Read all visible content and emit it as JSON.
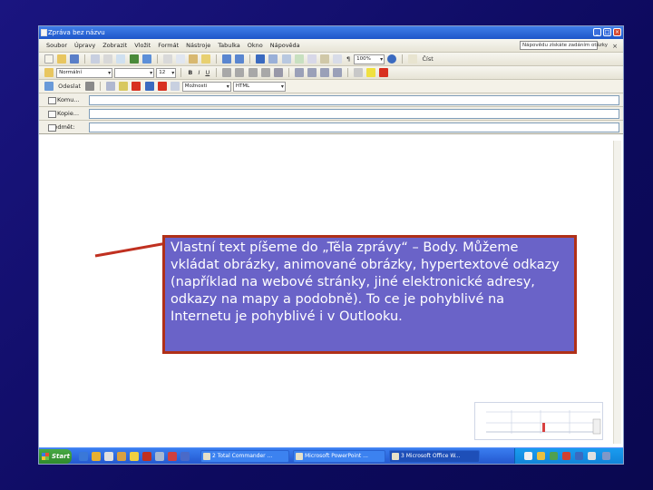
{
  "window": {
    "title": "Zpráva bez názvu"
  },
  "menu": {
    "items": [
      "Soubor",
      "Úpravy",
      "Zobrazit",
      "Vložit",
      "Formát",
      "Nástroje",
      "Tabulka",
      "Okno",
      "Nápověda"
    ],
    "help_box": "Nápovědu získáte zadáním otázky"
  },
  "toolbar": {
    "font_family": "Normální",
    "font_size": "12",
    "zoom": "100%",
    "read_label": "Číst"
  },
  "mailbar": {
    "send_label": "Odeslat",
    "account": "Možnosti",
    "format": "HTML"
  },
  "address": {
    "to_label": "Komu...",
    "cc_label": "Kopie...",
    "subject_label": "Předmět:"
  },
  "callout": {
    "text": "Vlastní text píšeme do „Těla zprávy“ – Body. Můžeme vkládat obrázky, animované obrázky, hypertextové odkazy (například na webové stránky, jiné elektronické adresy, odkazy na mapy a podobně). To ce je pohyblivé na Internetu je pohyblivé i v Outlooku."
  },
  "taskbar": {
    "start_label": "Start",
    "tasks": [
      "2 Total Commander ...",
      "Microsoft PowerPoint ...",
      "3 Microsoft Office W..."
    ]
  },
  "colors": {
    "slide_background": "#130f6e",
    "callout_fill": "#6a63c8",
    "callout_border": "#b03018",
    "titlebar": "#2a62d4"
  }
}
